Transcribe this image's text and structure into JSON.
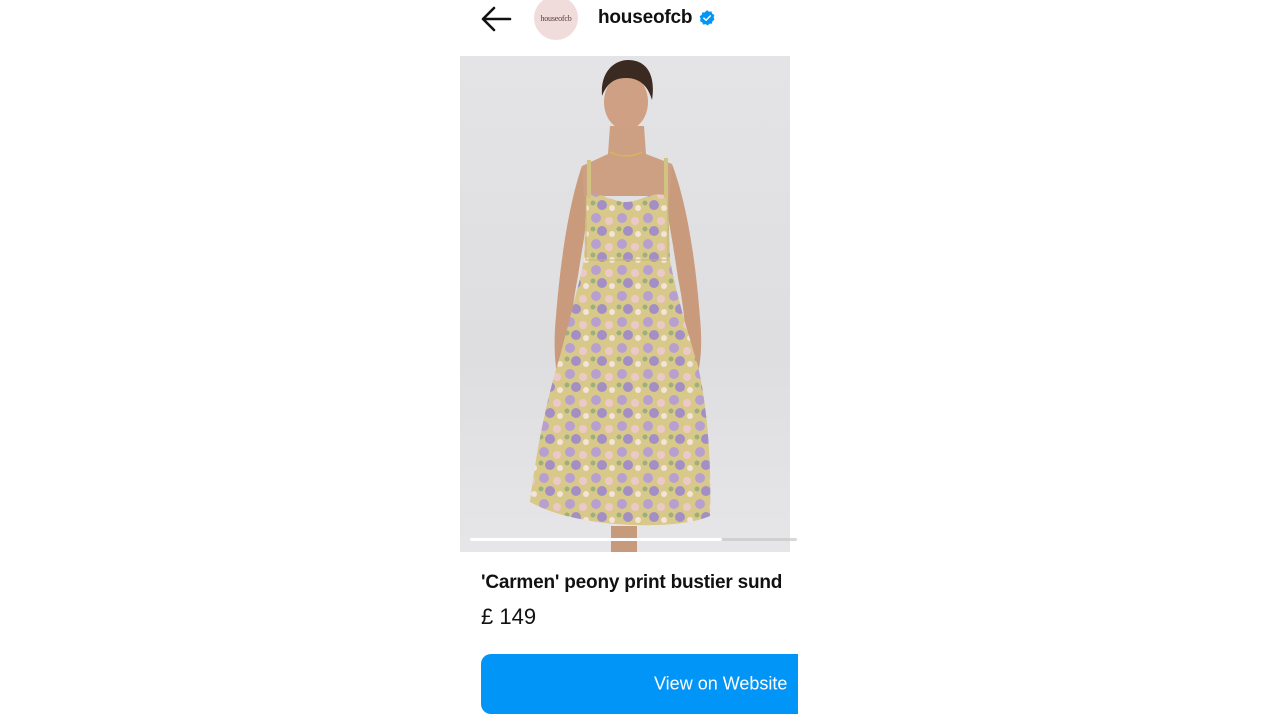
{
  "header": {
    "back_icon": "arrow-left-icon",
    "avatar_text": "houseofcb",
    "username": "houseofcb",
    "verified_icon": "verified-badge-icon",
    "verified_color": "#0095f6"
  },
  "product": {
    "image_icon": "product-photo",
    "image_progress": 0.77,
    "title": "'Carmen' peony print bustier sund",
    "price": "£ 149"
  },
  "cta": {
    "label": "View on Website",
    "color": "#0095f6"
  }
}
